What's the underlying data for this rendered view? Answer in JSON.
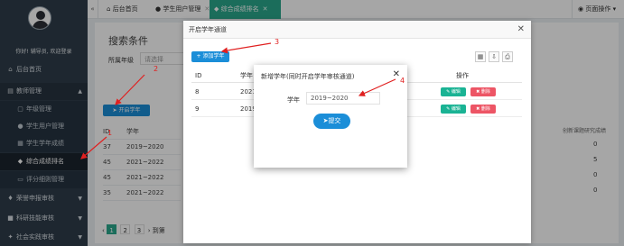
{
  "sidebar": {
    "welcome": "你好! 辅导员, 欢迎登录",
    "items": [
      {
        "label": "后台首页",
        "icon": "home-icon"
      },
      {
        "label": "教师管理",
        "icon": "book-icon"
      },
      {
        "label": "年级管理",
        "icon": "doc-icon"
      },
      {
        "label": "学生用户管理",
        "icon": "user-icon"
      },
      {
        "label": "学生学年成绩",
        "icon": "table-icon"
      },
      {
        "label": "综合成绩排名",
        "icon": "graduation-cap-icon"
      },
      {
        "label": "评分细则管理",
        "icon": "file-icon"
      },
      {
        "label": "荣誉申报审核",
        "icon": "trophy-icon"
      },
      {
        "label": "科研技能审核",
        "icon": "flask-icon"
      },
      {
        "label": "社会实践审核",
        "icon": "globe-icon"
      }
    ]
  },
  "tabs": [
    {
      "label": "后台首页",
      "icon": "home-icon"
    },
    {
      "label": "学生用户管理",
      "icon": "user-icon"
    },
    {
      "label": "综合成绩排名",
      "icon": "graduation-cap-icon"
    }
  ],
  "page_ops": "页面操作",
  "search": {
    "title": "搜索条件",
    "grade_label": "所属年级",
    "grade_placeholder": "请选择"
  },
  "bg_open_button": "开启学年",
  "bg_table": {
    "headers": [
      "ID",
      "学年"
    ],
    "rows": [
      [
        "37",
        "2019~2020"
      ],
      [
        "45",
        "2021~2022"
      ],
      [
        "45",
        "2021~2022"
      ],
      [
        "35",
        "2021~2022"
      ]
    ]
  },
  "right_col": {
    "header": "创新课题研究成绩",
    "values": [
      "0",
      "5",
      "0",
      "0"
    ]
  },
  "pager": [
    "1",
    "2",
    "3",
    "到第"
  ],
  "dialog1": {
    "title": "开启学年通道",
    "add_button": "添加学年",
    "headers": [
      "ID",
      "学年",
      "操作"
    ],
    "rows": [
      {
        "id": "8",
        "year": "2021"
      },
      {
        "id": "9",
        "year": "2019"
      }
    ],
    "edit_label": "编辑",
    "delete_label": "删除"
  },
  "dialog2": {
    "title": "新增学年(同时开启学年审核通道)",
    "year_label": "学年",
    "year_value": "2019~2020",
    "submit_label": "提交"
  },
  "annotations": [
    "1",
    "2",
    "3",
    "4"
  ],
  "colors": {
    "sidebar_bg": "#2f3d4a",
    "accent_teal": "#2aa88d",
    "primary_blue": "#1b8ed8",
    "annotation_red": "#e02020"
  }
}
